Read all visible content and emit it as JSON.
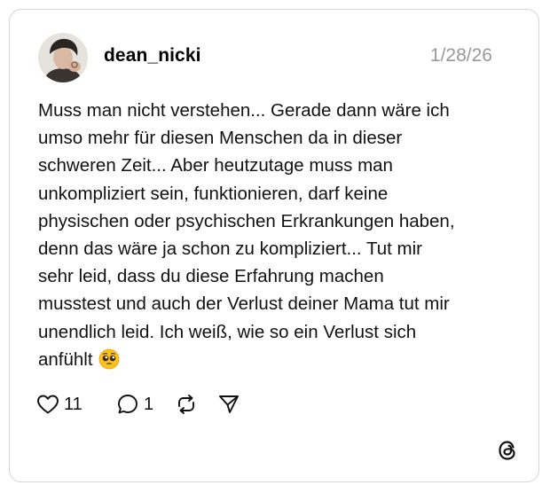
{
  "post": {
    "author": "dean_nicki",
    "date": "1/28/26",
    "text_lines": [
      "Muss man nicht verstehen... Gerade dann wäre ich",
      "umso mehr für diesen Menschen da in dieser",
      "schweren Zeit... Aber heutzutage muss man",
      "unkompliziert sein, funktionieren, darf keine",
      "physischen oder psychischen Erkrankungen haben,",
      "denn das wäre ja schon zu kompliziert... Tut mir",
      "sehr leid, dass du diese Erfahrung machen",
      "musstest und auch der Verlust deiner Mama tut mir",
      "unendlich leid. Ich weiß, wie so ein Verlust sich",
      "anfühlt"
    ],
    "emoji": "pleading-face-emoji"
  },
  "actions": {
    "likes": "11",
    "replies": "1",
    "icons": [
      "heart-icon",
      "comment-icon",
      "repost-icon",
      "share-icon"
    ]
  },
  "brand": {
    "logo": "threads-logo-icon"
  },
  "colors": {
    "border": "#d6d6d6",
    "muted": "#999999",
    "text": "#111111"
  }
}
